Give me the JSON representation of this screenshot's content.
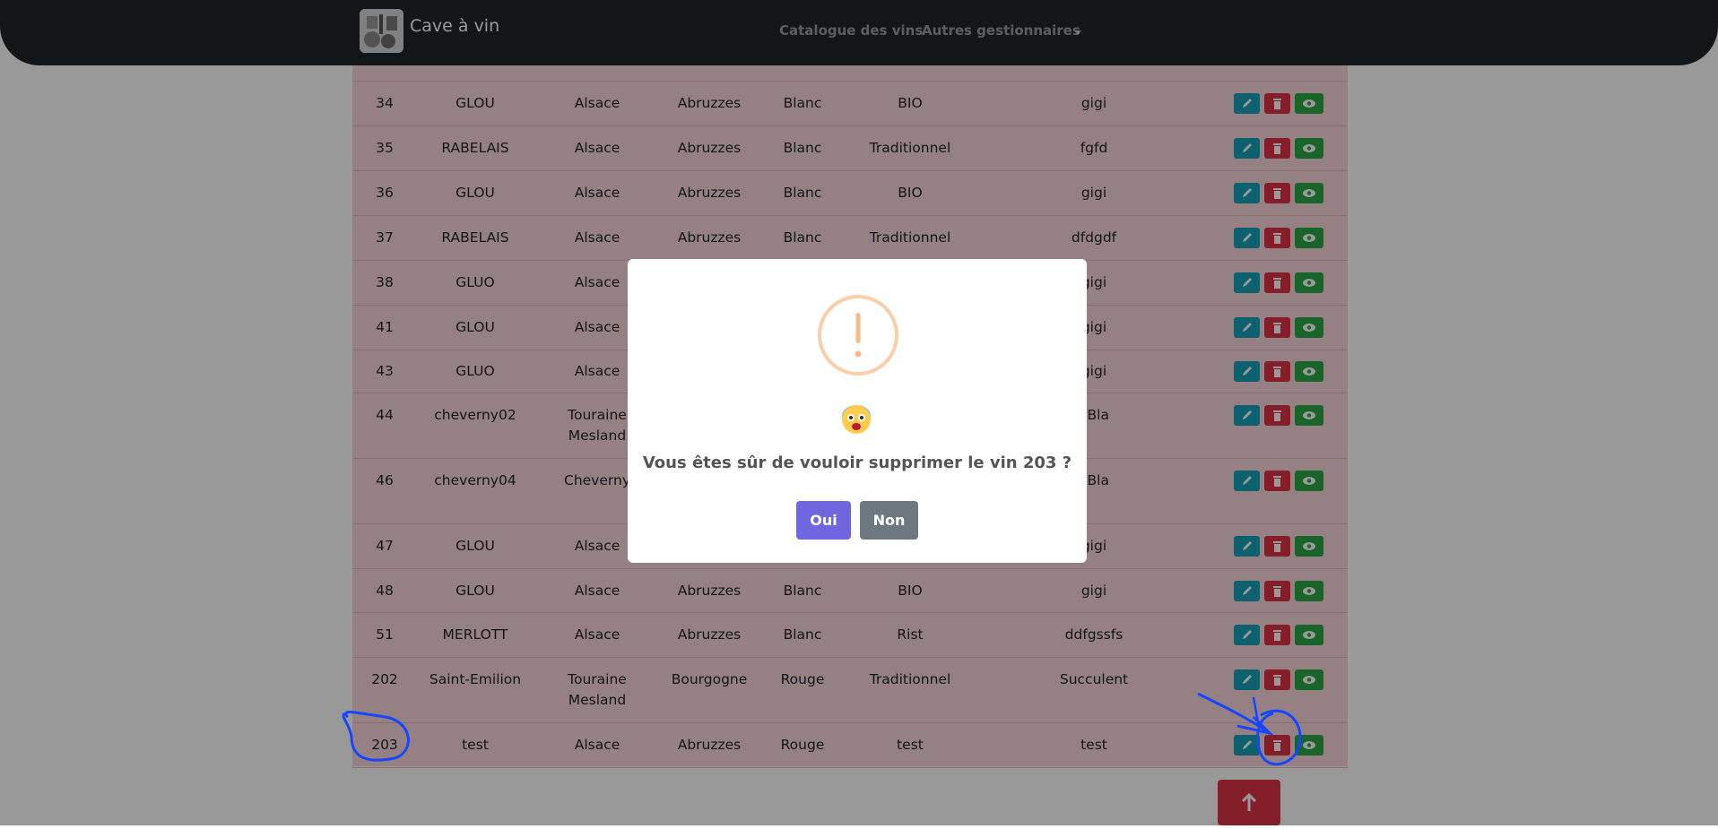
{
  "navbar": {
    "brand": "Cave à vin",
    "links": [
      "Catalogue des vins",
      "Autres gestionnaires"
    ]
  },
  "table": {
    "rows": [
      {
        "id": "34",
        "name": "GLOU",
        "region": "Alsace",
        "appellation": "Abruzzes",
        "color": "Blanc",
        "type": "BIO",
        "desc": "gigi"
      },
      {
        "id": "35",
        "name": "RABELAIS",
        "region": "Alsace",
        "appellation": "Abruzzes",
        "color": "Blanc",
        "type": "Traditionnel",
        "desc": "fgfd"
      },
      {
        "id": "36",
        "name": "GLOU",
        "region": "Alsace",
        "appellation": "Abruzzes",
        "color": "Blanc",
        "type": "BIO",
        "desc": "gigi"
      },
      {
        "id": "37",
        "name": "RABELAIS",
        "region": "Alsace",
        "appellation": "Abruzzes",
        "color": "Blanc",
        "type": "Traditionnel",
        "desc": "dfdgdf"
      },
      {
        "id": "38",
        "name": "GLUO",
        "region": "Alsace",
        "appellation": "",
        "color": "",
        "type": "",
        "desc": "gigi"
      },
      {
        "id": "41",
        "name": "GLOU",
        "region": "Alsace",
        "appellation": "",
        "color": "",
        "type": "",
        "desc": "gigi"
      },
      {
        "id": "43",
        "name": "GLUO",
        "region": "Alsace",
        "appellation": "",
        "color": "",
        "type": "",
        "desc": "gigi"
      },
      {
        "id": "44",
        "name": "cheverny02",
        "region": "Touraine\nMesland",
        "appellation": "",
        "color": "",
        "type": "",
        "desc": "aBla"
      },
      {
        "id": "46",
        "name": "cheverny04",
        "region": "Cheverny",
        "appellation": "",
        "color": "",
        "type": "",
        "desc": "aBla"
      },
      {
        "id": "47",
        "name": "GLOU",
        "region": "Alsace",
        "appellation": "",
        "color": "",
        "type": "",
        "desc": "gigi"
      },
      {
        "id": "48",
        "name": "GLOU",
        "region": "Alsace",
        "appellation": "Abruzzes",
        "color": "Blanc",
        "type": "BIO",
        "desc": "gigi"
      },
      {
        "id": "51",
        "name": "MERLOTT",
        "region": "Alsace",
        "appellation": "Abruzzes",
        "color": "Blanc",
        "type": "Rist",
        "desc": "ddfgssfs"
      },
      {
        "id": "202",
        "name": "Saint-Emilion",
        "region": "Touraine\nMesland",
        "appellation": "Bourgogne",
        "color": "Rouge",
        "type": "Traditionnel",
        "desc": "Succulent"
      },
      {
        "id": "203",
        "name": "test",
        "region": "Alsace",
        "appellation": "Abruzzes",
        "color": "Rouge",
        "type": "test",
        "desc": "test"
      }
    ]
  },
  "dialog": {
    "message": "Vous êtes sûr de vouloir supprimer le vin 203 ?",
    "confirm_label": "Oui",
    "cancel_label": "Non",
    "emoji": "😨"
  },
  "icons": {
    "edit": "pencil-icon",
    "delete": "trash-icon",
    "view": "eye-icon",
    "scroll_top": "arrow-up-icon",
    "warning": "exclamation-icon"
  },
  "colors": {
    "row_bg": "#f8d7da",
    "edit_btn": "#17a2b8",
    "delete_btn": "#dc3545",
    "view_btn": "#28a745",
    "confirm_btn": "#7066e0",
    "cancel_btn": "#6e7881",
    "warning": "#facea8",
    "annotation": "#1746ff"
  }
}
